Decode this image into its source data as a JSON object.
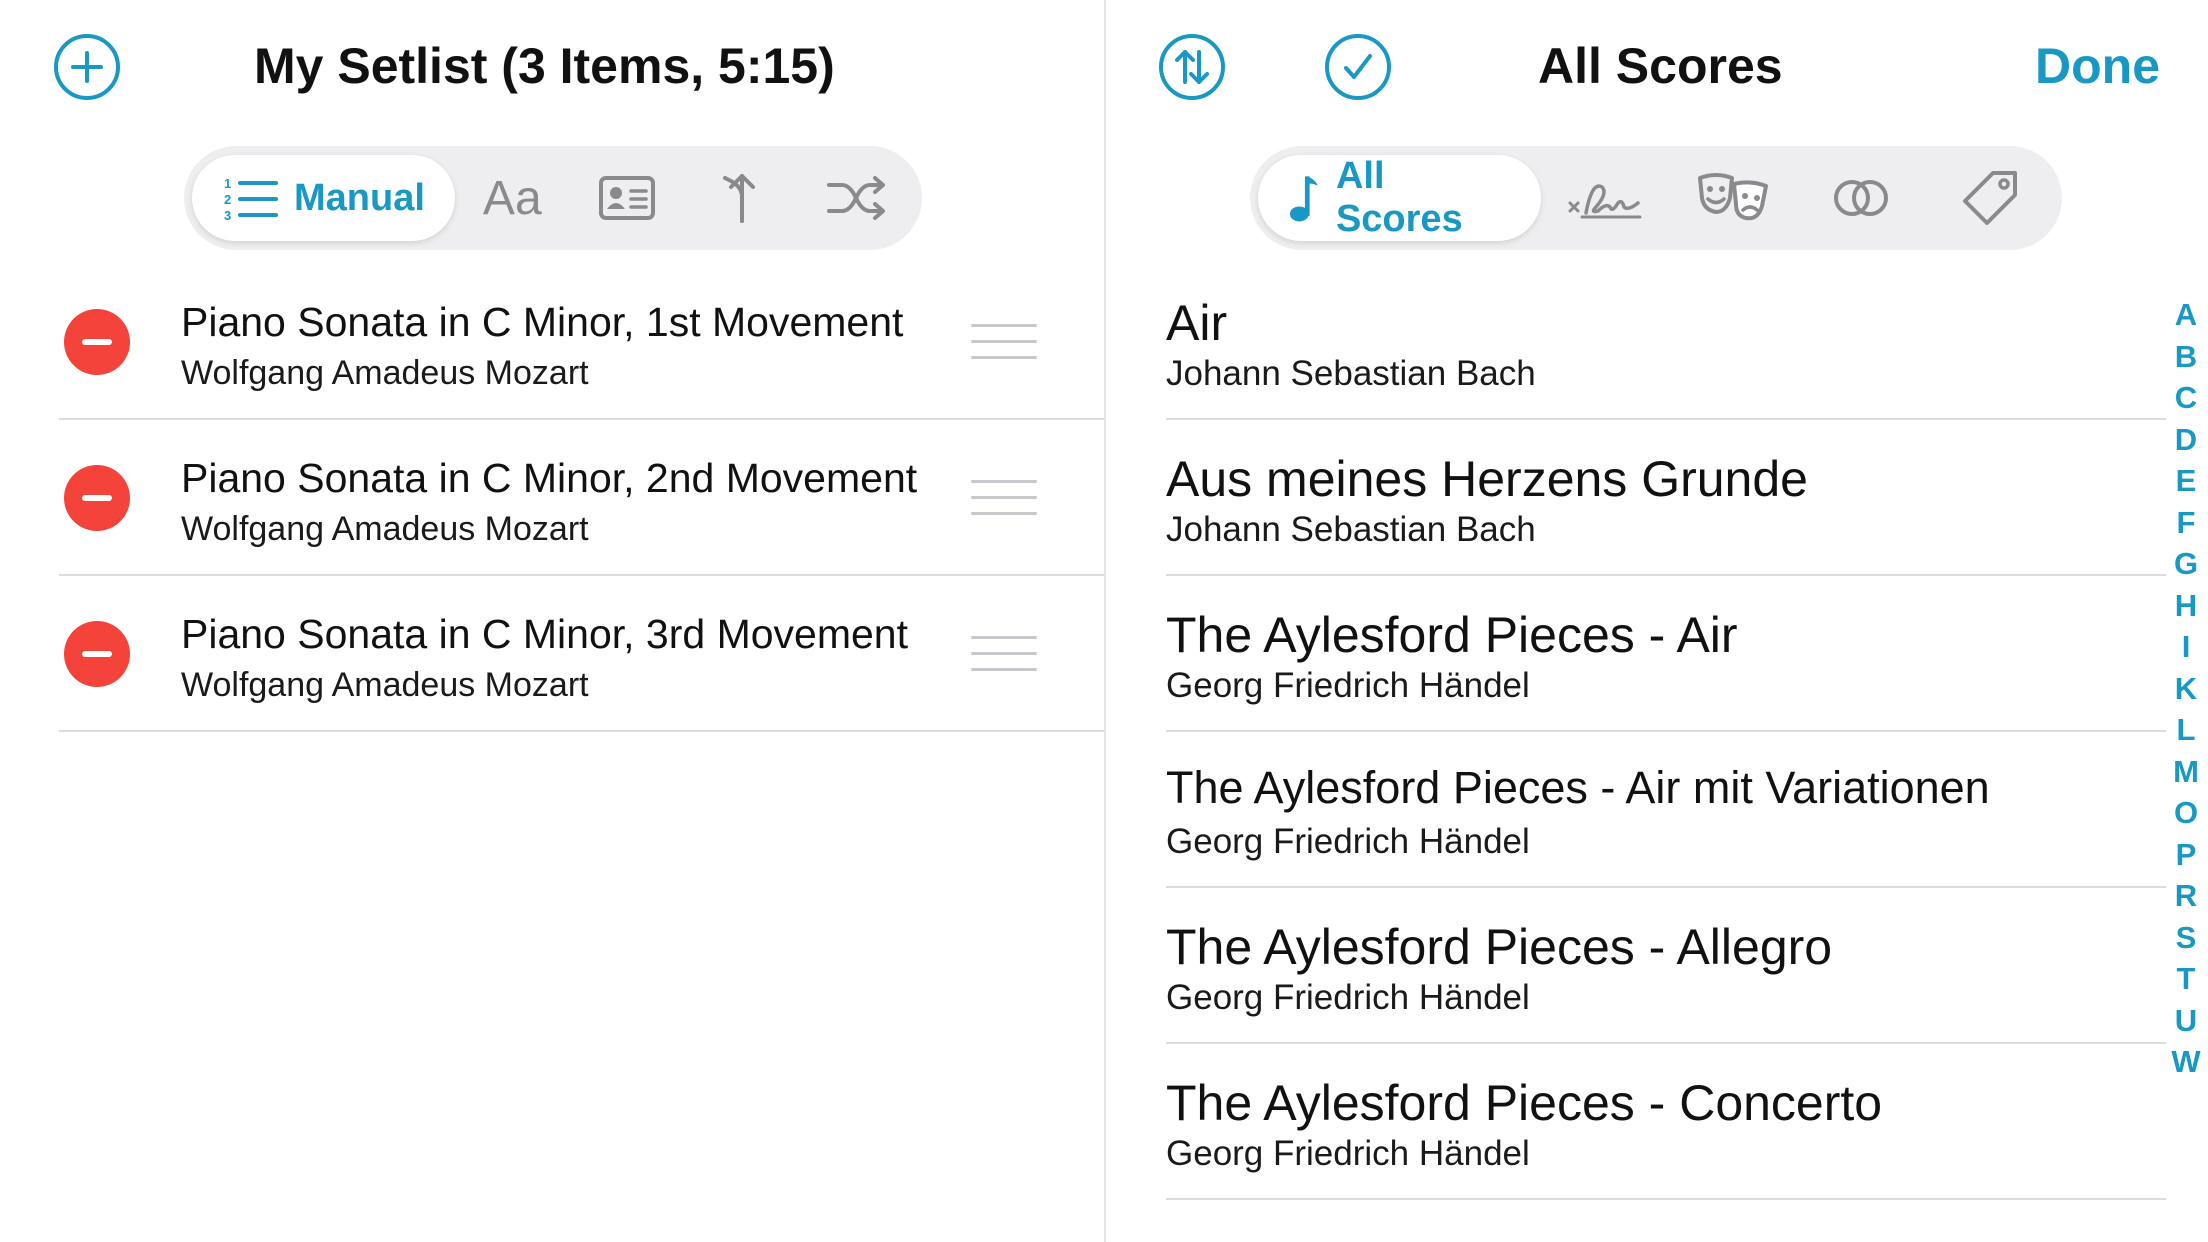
{
  "setlist": {
    "title": "My Setlist (3 Items, 5:15)",
    "add_icon": "plus-circle-icon",
    "sort_modes": [
      {
        "name": "Manual",
        "icon": "numbered-list-icon",
        "active": true
      },
      {
        "name": "",
        "icon": "text-aa-icon",
        "glyph": "Aa"
      },
      {
        "name": "",
        "icon": "id-card-icon"
      },
      {
        "name": "",
        "icon": "merge-arrow-up-icon"
      },
      {
        "name": "",
        "icon": "shuffle-icon"
      }
    ],
    "items": [
      {
        "title": "Piano Sonata in C Minor, 1st Movement",
        "composer": "Wolfgang Amadeus Mozart"
      },
      {
        "title": "Piano Sonata in C Minor, 2nd Movement",
        "composer": "Wolfgang Amadeus Mozart"
      },
      {
        "title": "Piano Sonata in C Minor, 3rd Movement",
        "composer": "Wolfgang Amadeus Mozart"
      }
    ]
  },
  "library": {
    "title": "All Scores",
    "done_label": "Done",
    "sort_icon": "sort-arrows-circle-icon",
    "select_icon": "checkmark-circle-icon",
    "filters": [
      {
        "name": "All Scores",
        "icon": "music-note-icon",
        "active": true
      },
      {
        "name": "",
        "icon": "signature-icon"
      },
      {
        "name": "",
        "icon": "theater-masks-icon"
      },
      {
        "name": "",
        "icon": "toggle-circles-icon"
      },
      {
        "name": "",
        "icon": "tag-icon"
      }
    ],
    "scores": [
      {
        "title": "Air",
        "composer": "Johann Sebastian Bach"
      },
      {
        "title": "Aus meines Herzens Grunde",
        "composer": "Johann Sebastian Bach"
      },
      {
        "title": "The Aylesford Pieces - Air",
        "composer": "Georg Friedrich Händel"
      },
      {
        "title": "The Aylesford Pieces - Air mit Variationen",
        "composer": "Georg Friedrich Händel"
      },
      {
        "title": "The Aylesford Pieces - Allegro",
        "composer": "Georg Friedrich Händel"
      },
      {
        "title": "The Aylesford Pieces - Concerto",
        "composer": "Georg Friedrich Händel"
      }
    ],
    "index_letters": [
      "A",
      "B",
      "C",
      "D",
      "E",
      "F",
      "G",
      "H",
      "I",
      "K",
      "L",
      "M",
      "O",
      "P",
      "R",
      "S",
      "T",
      "U",
      "W"
    ]
  },
  "colors": {
    "accent": "#1a98c4",
    "delete": "#f4433a",
    "separator": "#dcdcdf",
    "segment_bg": "#eeeef0",
    "icon_gray": "#8a8a8e"
  }
}
